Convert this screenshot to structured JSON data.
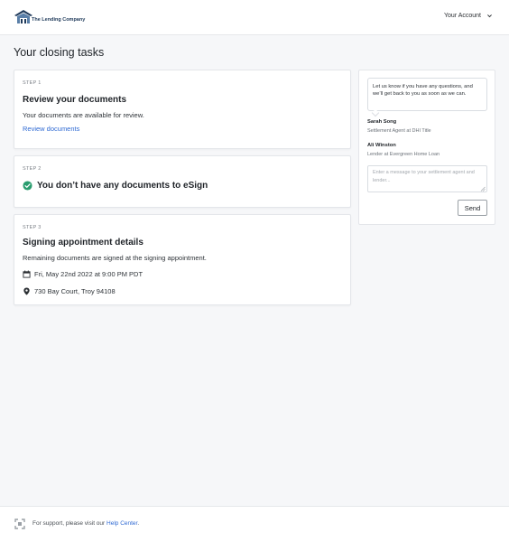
{
  "header": {
    "logo_text": "The Lending Company",
    "account_label": "Your Account"
  },
  "page": {
    "title": "Your closing tasks"
  },
  "steps": [
    {
      "label": "STEP 1",
      "title": "Review your documents",
      "text": "Your documents are available for review.",
      "link": "Review documents"
    },
    {
      "label": "STEP 2",
      "title": "You don’t have any documents to eSign"
    },
    {
      "label": "STEP 3",
      "title": "Signing appointment details",
      "text": "Remaining documents are signed at the signing appointment.",
      "date": "Fri, May 22nd 2022 at 9:00 PM PDT",
      "address": "730 Bay Court, Troy 94108"
    }
  ],
  "chat": {
    "bubble_text": "Let us know if you have any questions, and we’ll get back to you as soon as we can.",
    "contacts": [
      {
        "name": "Sarah Song",
        "role": "Settlement Agent at DHI Title"
      },
      {
        "name": "Ali Winston",
        "role": "Lender at Evergreen Home Loan"
      }
    ],
    "input_placeholder": "Enter a message to your settlement agent and lender...",
    "input_value": "",
    "send_label": "Send"
  },
  "footer": {
    "text_prefix": "For support, please visit our ",
    "link_text": "Help Center",
    "text_suffix": "."
  },
  "colors": {
    "accent_link": "#2f6ad3",
    "success": "#2a9d6f",
    "logo_blue": "#1f3a5a",
    "background": "#f6f7f9"
  },
  "icons": {
    "logo": "house-roof-logo-icon",
    "account": "chevron-down-icon",
    "step2": "check-circle-icon",
    "date": "calendar-icon",
    "address": "map-pin-icon",
    "footer": "support-frame-icon"
  }
}
